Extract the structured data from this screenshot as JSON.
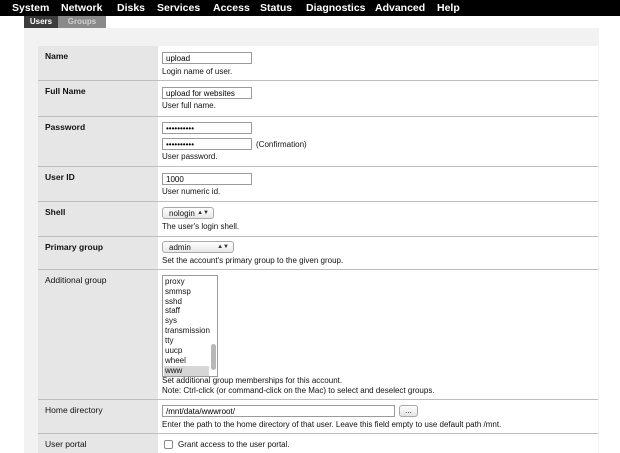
{
  "nav": [
    "System",
    "Network",
    "Disks",
    "Services",
    "Access",
    "Status",
    "Diagnostics",
    "Advanced",
    "Help"
  ],
  "tabs": {
    "users": "Users",
    "groups": "Groups"
  },
  "name": {
    "label": "Name",
    "value": "upload",
    "help": "Login name of user."
  },
  "fullname": {
    "label": "Full Name",
    "value": "upload for websites",
    "help": "User full name."
  },
  "password": {
    "label": "Password",
    "value": "••••••••••",
    "confirm_value": "••••••••••",
    "confirm_label": "(Confirmation)",
    "help": "User password."
  },
  "userid": {
    "label": "User ID",
    "value": "1000",
    "help": "User numeric id."
  },
  "shell": {
    "label": "Shell",
    "value": "nologin",
    "help": "The user's login shell."
  },
  "primary": {
    "label": "Primary group",
    "value": "admin",
    "help": "Set the account's primary group to the given group."
  },
  "additional": {
    "label": "Additional group",
    "options": [
      "proxy",
      "smmsp",
      "sshd",
      "staff",
      "sys",
      "transmission",
      "tty",
      "uucp",
      "wheel",
      "www"
    ],
    "selected": "www",
    "help1": "Set additional group memberships for this account.",
    "help2": "Note: Ctrl-click (or command-click on the Mac) to select and deselect groups."
  },
  "homedir": {
    "label": "Home directory",
    "value": "/mnt/data/wwwroot/",
    "browse": "...",
    "help": "Enter the path to the home directory of that user. Leave this field empty to use default path /mnt."
  },
  "portal": {
    "label": "User portal",
    "checkbox_label": "Grant access to the user portal."
  }
}
